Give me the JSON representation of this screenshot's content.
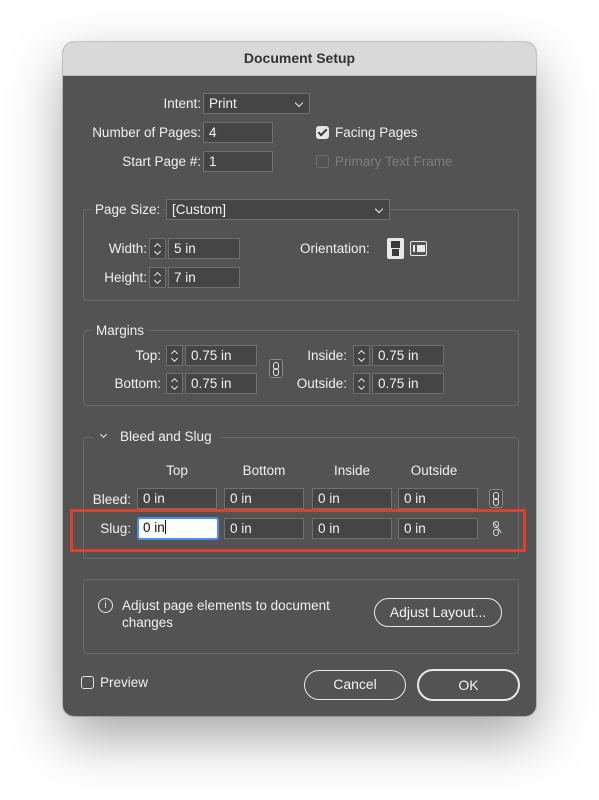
{
  "dialog": {
    "title": "Document Setup"
  },
  "intent": {
    "label": "Intent:",
    "value": "Print"
  },
  "pages": {
    "label": "Number of Pages:",
    "value": "4"
  },
  "start_page": {
    "label": "Start Page #:",
    "value": "1"
  },
  "facing_pages": {
    "label": "Facing Pages",
    "checked": true
  },
  "primary_text_frame": {
    "label": "Primary Text Frame",
    "checked": false,
    "disabled": true
  },
  "page_size": {
    "label": "Page Size:",
    "value": "[Custom]",
    "width_label": "Width:",
    "width": "5 in",
    "height_label": "Height:",
    "height": "7 in",
    "orientation_label": "Orientation:",
    "orientation": "portrait"
  },
  "margins": {
    "title": "Margins",
    "top_label": "Top:",
    "top": "0.75 in",
    "bottom_label": "Bottom:",
    "bottom": "0.75 in",
    "inside_label": "Inside:",
    "inside": "0.75 in",
    "outside_label": "Outside:",
    "outside": "0.75 in",
    "linked": true
  },
  "bleed_slug": {
    "title": "Bleed and Slug",
    "expanded": true,
    "columns": [
      "Top",
      "Bottom",
      "Inside",
      "Outside"
    ],
    "bleed_label": "Bleed:",
    "bleed": [
      "0 in",
      "0 in",
      "0 in",
      "0 in"
    ],
    "slug_label": "Slug:",
    "slug": [
      "0 in",
      "0 in",
      "0 in",
      "0 in"
    ],
    "bleed_linked": true,
    "slug_linked": false,
    "highlight_color": "#e0402a"
  },
  "adjust": {
    "message": "Adjust page elements to document changes",
    "button": "Adjust Layout..."
  },
  "footer": {
    "preview_label": "Preview",
    "preview_checked": false,
    "cancel": "Cancel",
    "ok": "OK"
  },
  "colors": {
    "dialog_bg": "#535353",
    "field_bg": "#454545",
    "focus": "#4a8ee8"
  }
}
